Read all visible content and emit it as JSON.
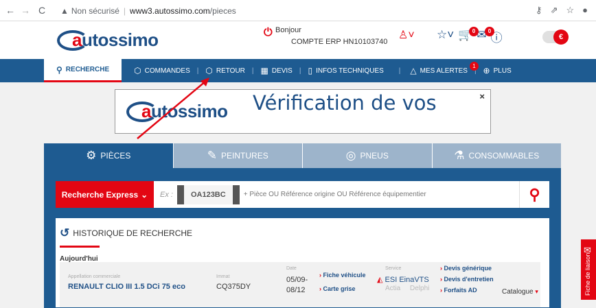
{
  "browser": {
    "back": "←",
    "forward": "→",
    "reload": "C",
    "security_warning": "Non sécurisé",
    "url_host": "www3.autossimo.com",
    "url_path": "/pieces"
  },
  "header": {
    "logo_text_a": "a",
    "logo_text_rest": "utossimo",
    "greeting": "Bonjour",
    "account": "COMPTE ERP HN10103740",
    "cart_count": "0",
    "mail_count": "0",
    "currency_symbol": "€"
  },
  "navbar": {
    "items": [
      {
        "label": "RECHERCHE",
        "icon": "search-icon"
      },
      {
        "label": "COMMANDES",
        "icon": "box-icon"
      },
      {
        "label": "RETOUR",
        "icon": "box-icon"
      },
      {
        "label": "DEVIS",
        "icon": "calendar-icon"
      },
      {
        "label": "INFOS TECHNIQUES",
        "icon": "clipboard-icon"
      },
      {
        "label": "MES ALERTES",
        "icon": "warning-icon"
      },
      {
        "label": "PLUS",
        "icon": "plus-circle-icon"
      }
    ],
    "alerts_count": "1"
  },
  "banner": {
    "logo_text_a": "a",
    "logo_text_rest": "utossimo",
    "title": "Vérification de vos",
    "close": "×"
  },
  "tabs": [
    {
      "label": "PIÈCES",
      "active": true
    },
    {
      "label": "PEINTURES",
      "active": false
    },
    {
      "label": "PNEUS",
      "active": false
    },
    {
      "label": "CONSOMMABLES",
      "active": false
    }
  ],
  "search": {
    "type_label": "Recherche Express",
    "ex_label": "Ex :",
    "plate_example": "OA123BC",
    "placeholder": "+ Pièce OU Référence origine OU Référence équipementier"
  },
  "history": {
    "title": "HISTORIQUE DE RECHERCHE",
    "today_label": "Aujourd'hui",
    "entry": {
      "appellation_label": "Appellation commerciale",
      "appellation": "RENAULT CLIO III 1.5 DCi 75 eco",
      "immat_label": "Immat",
      "immat": "CQ375DY",
      "date_label": "Date",
      "date_line1": "05/09-",
      "date_line2": "08/12",
      "link_fiche": "Fiche véhicule",
      "link_carte": "Carte grise",
      "service_label": "Service",
      "service_value": "ESI EinaVTS",
      "service_sub1": "Actia",
      "service_sub2": "Delphi",
      "link_devis": "Devis générique",
      "link_entretien": "Devis d'entretien",
      "link_forfaits": "Forfaits AD",
      "catalogue": "Catalogue"
    }
  },
  "side_tab": {
    "label": "Fiche de liaison"
  }
}
